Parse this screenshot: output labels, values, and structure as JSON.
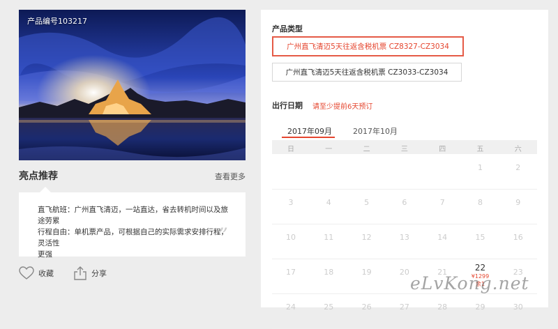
{
  "product": {
    "number_label": "产品编号103217"
  },
  "highlights": {
    "title": "亮点推荐",
    "view_more": "查看更多",
    "lines": [
      "直飞航班：广州直飞清迈，一站直达，省去转机时间以及旅途劳累",
      "行程自由：单机票产品，可根据自己的实际需求安排行程，灵活性",
      "更强"
    ]
  },
  "actions": {
    "favorite": "收藏",
    "share": "分享"
  },
  "booking": {
    "product_type_label": "产品类型",
    "options": [
      "广州直飞清迈5天往返含税机票 CZ8327-CZ3034",
      "广州直飞清迈5天往返含税机票 CZ3033-CZ3034"
    ],
    "selected_option": 0,
    "date_label": "出行日期",
    "date_hint": "请至少提前6天预订",
    "month_tabs": [
      "2017年09月",
      "2017年10月"
    ],
    "active_month": 0,
    "weekdays": [
      "日",
      "一",
      "二",
      "三",
      "四",
      "五",
      "六"
    ],
    "weeks": [
      [
        "",
        "",
        "",
        "",
        "",
        "1",
        "2"
      ],
      [
        "3",
        "4",
        "5",
        "6",
        "7",
        "8",
        "9"
      ],
      [
        "10",
        "11",
        "12",
        "13",
        "14",
        "15",
        "16"
      ],
      [
        "17",
        "18",
        "19",
        "20",
        "21",
        "22",
        "23"
      ],
      [
        "24",
        "25",
        "26",
        "27",
        "28",
        "29",
        "30"
      ]
    ],
    "available_day": {
      "day": "22",
      "price": "¥1299",
      "remaining": "余1"
    }
  },
  "watermark": "eLvKong.net",
  "colors": {
    "accent": "#e5452e",
    "background": "#ededed",
    "panel": "#ffffff"
  }
}
